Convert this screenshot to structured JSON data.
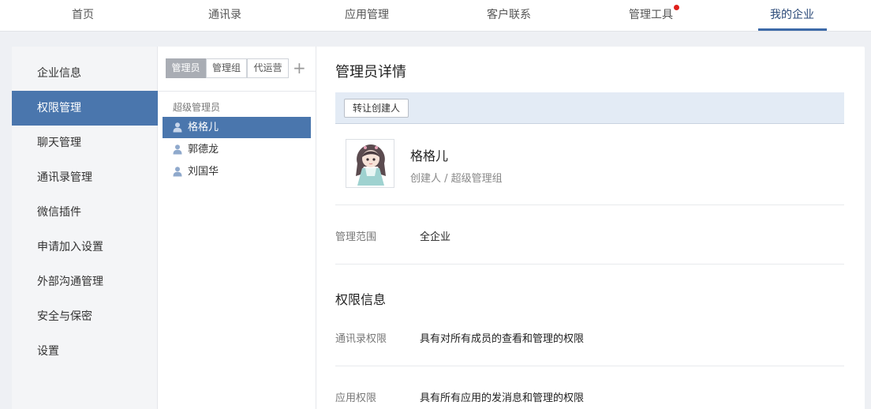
{
  "topnav": {
    "items": [
      "首页",
      "通讯录",
      "应用管理",
      "客户联系",
      "管理工具",
      "我的企业"
    ],
    "active_index": 5,
    "notification_on": "管理工具"
  },
  "sidebar": {
    "items": [
      "企业信息",
      "权限管理",
      "聊天管理",
      "通讯录管理",
      "微信插件",
      "申请加入设置",
      "外部沟通管理",
      "安全与保密",
      "设置"
    ],
    "active_index": 1
  },
  "admin_list": {
    "tabs": [
      "管理员",
      "管理组",
      "代运营"
    ],
    "active_tab": 0,
    "add_symbol": "+",
    "group_label": "超级管理员",
    "members": [
      "格格儿",
      "郭德龙",
      "刘国华"
    ],
    "selected_index": 0
  },
  "detail": {
    "title": "管理员详情",
    "transfer_button": "转让创建人",
    "profile": {
      "name": "格格儿",
      "role": "创建人 / 超级管理组"
    },
    "scope_label": "管理范围",
    "scope_value": "全企业",
    "perm_section_title": "权限信息",
    "permissions": [
      {
        "label": "通讯录权限",
        "value": "具有对所有成员的查看和管理的权限"
      },
      {
        "label": "应用权限",
        "value": "具有所有应用的发消息和管理的权限"
      }
    ]
  },
  "colors": {
    "accent": "#4a76ad",
    "nav_active": "#2b4a78",
    "notify_dot": "#e0201b",
    "toolbar_bg": "#e3ebf5"
  }
}
